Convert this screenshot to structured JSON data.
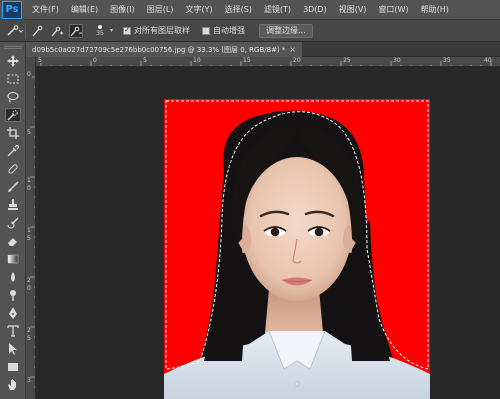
{
  "app": {
    "logo": "Ps"
  },
  "menu": {
    "items": [
      "文件(F)",
      "编辑(E)",
      "图像(I)",
      "图层(L)",
      "文字(Y)",
      "选择(S)",
      "滤镜(T)",
      "3D(D)",
      "视图(V)",
      "窗口(W)",
      "帮助(H)"
    ]
  },
  "options": {
    "brush_size": "35",
    "sample_all_layers_label": "对所有图层取样",
    "auto_enhance_label": "自动增强",
    "refine_edge_label": "调整边缘..."
  },
  "document": {
    "tab_title": "d09b5c0a027d72709c5e276bb0c00756.jpg @ 33.3% (图层 0, RGB/8#) *",
    "close_glyph": "×"
  },
  "rulers": {
    "top_labels": [
      "5",
      "0",
      "5",
      "10",
      "15",
      "20",
      "25",
      "30",
      "35",
      "40"
    ],
    "left_labels": [
      "0",
      "5",
      "1",
      "0",
      "1",
      "5",
      "2",
      "0",
      "2",
      "5",
      "3"
    ]
  },
  "colors": {
    "background_red": "#ff0000",
    "workspace": "#282828",
    "panel": "#535353",
    "shirt": "#dde7f0"
  }
}
